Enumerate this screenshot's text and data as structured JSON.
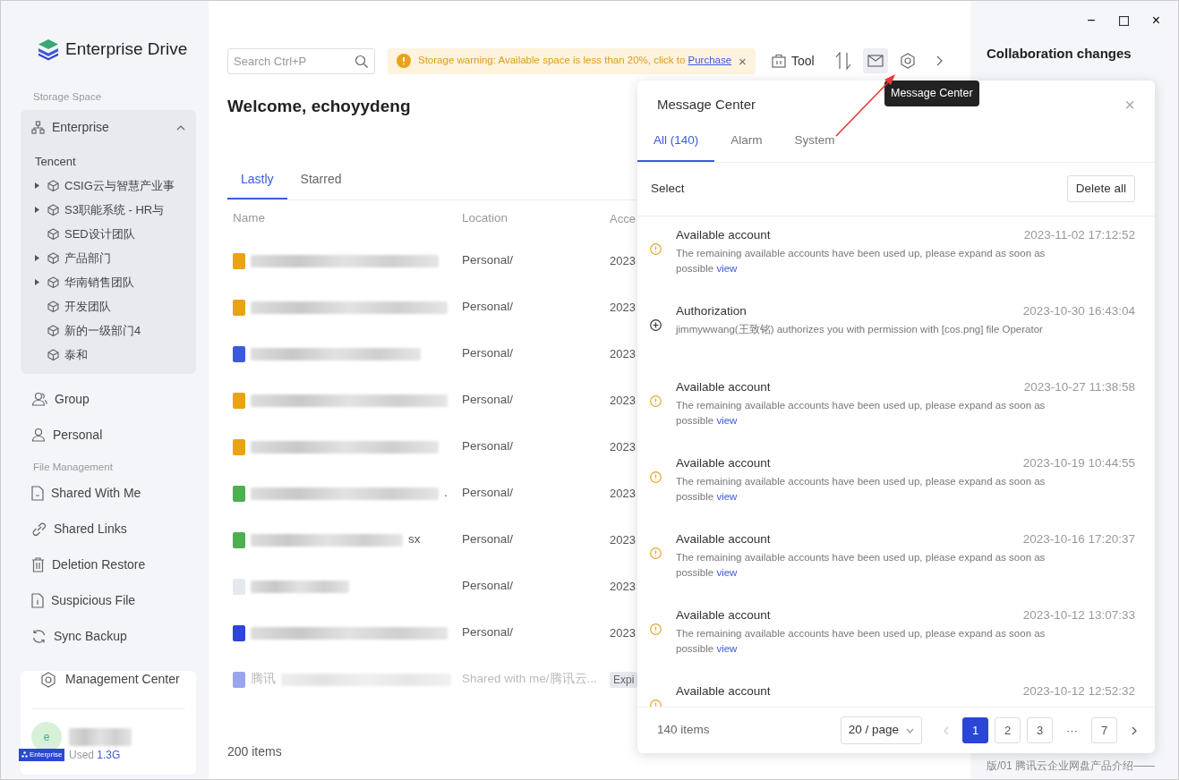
{
  "app": {
    "logo_text": "Enterprise Drive"
  },
  "sidebar": {
    "storage_label": "Storage Space",
    "enterprise": {
      "label": "Enterprise",
      "expanded": true,
      "org": "Tencent",
      "departments": [
        {
          "label": "CSIG云与智慧产业事",
          "expandable": true
        },
        {
          "label": "S3职能系统 - HR与",
          "expandable": true
        },
        {
          "label": "SED设计团队",
          "expandable": false
        },
        {
          "label": "产品部门",
          "expandable": true
        },
        {
          "label": "华南销售团队",
          "expandable": true
        },
        {
          "label": "开发团队",
          "expandable": false
        },
        {
          "label": "新的一级部门4",
          "expandable": false
        },
        {
          "label": "泰和",
          "expandable": false
        }
      ]
    },
    "spaces": [
      {
        "label": "Group"
      },
      {
        "label": "Personal"
      }
    ],
    "file_label": "File Management",
    "file_items": [
      {
        "label": "Shared With Me"
      },
      {
        "label": "Shared Links"
      },
      {
        "label": "Deletion Restore"
      },
      {
        "label": "Suspicious File"
      },
      {
        "label": "Sync Backup"
      }
    ],
    "management": {
      "label": "Management Center",
      "avatar": "e",
      "badge": "Enterprise",
      "used_label": "Used",
      "used_value": "1.3G"
    }
  },
  "toolbar": {
    "search_placeholder": "Search Ctrl+P",
    "warning": {
      "text": "Storage warning: Available space is less than 20%, click to ",
      "link": "Purchase",
      "close": "×"
    },
    "tool": "Tool"
  },
  "window_controls": {
    "minimize": "−",
    "close": "×"
  },
  "main": {
    "welcome": "Welcome, echoyydeng",
    "tabs": [
      {
        "label": "Lastly",
        "selected": true
      },
      {
        "label": "Starred",
        "selected": false
      }
    ],
    "columns": [
      "Name",
      "Location",
      "Acce"
    ],
    "rows": [
      {
        "color": "#e8a317",
        "name_tail": "",
        "location": "Personal/",
        "access": "2023",
        "expired": false
      },
      {
        "color": "#e8a317",
        "name_tail": "",
        "location": "Personal/",
        "access": "2023",
        "expired": false
      },
      {
        "color": "#3b5bdb",
        "name_tail": "",
        "location": "Personal/",
        "access": "2023",
        "expired": false
      },
      {
        "color": "#e8a317",
        "name_tail": "",
        "location": "Personal/",
        "access": "2023",
        "expired": false
      },
      {
        "color": "#e8a317",
        "name_tail": "",
        "location": "Personal/",
        "access": "2023",
        "expired": false
      },
      {
        "color": "#4caf50",
        "name_tail": ".",
        "location": "Personal/",
        "access": "2023",
        "expired": false
      },
      {
        "color": "#4caf50",
        "name_tail": "sx",
        "location": "Personal/",
        "access": "2023",
        "expired": false
      },
      {
        "color": "#e6e8ef",
        "name_tail": "",
        "location": "Personal/",
        "access": "2023",
        "expired": false
      },
      {
        "color": "#2f45d6",
        "name_tail": "",
        "location": "Personal/",
        "access": "2023",
        "expired": false
      },
      {
        "color": "#9aa5f0",
        "name_head": "腾讯",
        "name_tail": "",
        "location": "Shared with me/腾讯云...",
        "access": "Expi",
        "expired": true
      }
    ],
    "count": "200 items"
  },
  "right_panel": {
    "title": "Collaboration changes",
    "footer": "版/01 腾讯云企业网盘产品介绍——"
  },
  "tooltip": "Message Center",
  "message_center": {
    "title": "Message Center",
    "close": "×",
    "tabs": [
      {
        "label": "All (140)",
        "selected": true
      },
      {
        "label": "Alarm",
        "selected": false
      },
      {
        "label": "System",
        "selected": false
      }
    ],
    "select": "Select",
    "delete_all": "Delete all",
    "messages": [
      {
        "kind": "warning",
        "title": "Available account",
        "time": "2023-11-02 17:12:52",
        "text": "The remaining available accounts have been used up, please expand as soon as possible",
        "link": "view"
      },
      {
        "kind": "authorization",
        "title": "Authorization",
        "time": "2023-10-30 16:43:04",
        "text": "jimmywwang(王致铭) authorizes you with permission with [cos.png] file Operator"
      },
      {
        "kind": "warning",
        "title": "Available account",
        "time": "2023-10-27 11:38:58",
        "text": "The remaining available accounts have been used up, please expand as soon as possible",
        "link": "view"
      },
      {
        "kind": "warning",
        "title": "Available account",
        "time": "2023-10-19 10:44:55",
        "text": "The remaining available accounts have been used up, please expand as soon as possible",
        "link": "view"
      },
      {
        "kind": "warning",
        "title": "Available account",
        "time": "2023-10-16 17:20:37",
        "text": "The remaining available accounts have been used up, please expand as soon as possible",
        "link": "view"
      },
      {
        "kind": "warning",
        "title": "Available account",
        "time": "2023-10-12 13:07:33",
        "text": "The remaining available accounts have been used up, please expand as soon as possible",
        "link": "view"
      },
      {
        "kind": "warning",
        "title": "Available account",
        "time": "2023-10-12 12:52:32"
      }
    ],
    "pagination": {
      "total": "140 items",
      "page_size": "20 / page",
      "pages": [
        {
          "label": "1",
          "selected": true
        },
        {
          "label": "2",
          "selected": false
        },
        {
          "label": "3",
          "selected": false
        },
        {
          "label": "···",
          "selected": false
        },
        {
          "label": "7",
          "selected": false
        }
      ]
    }
  }
}
